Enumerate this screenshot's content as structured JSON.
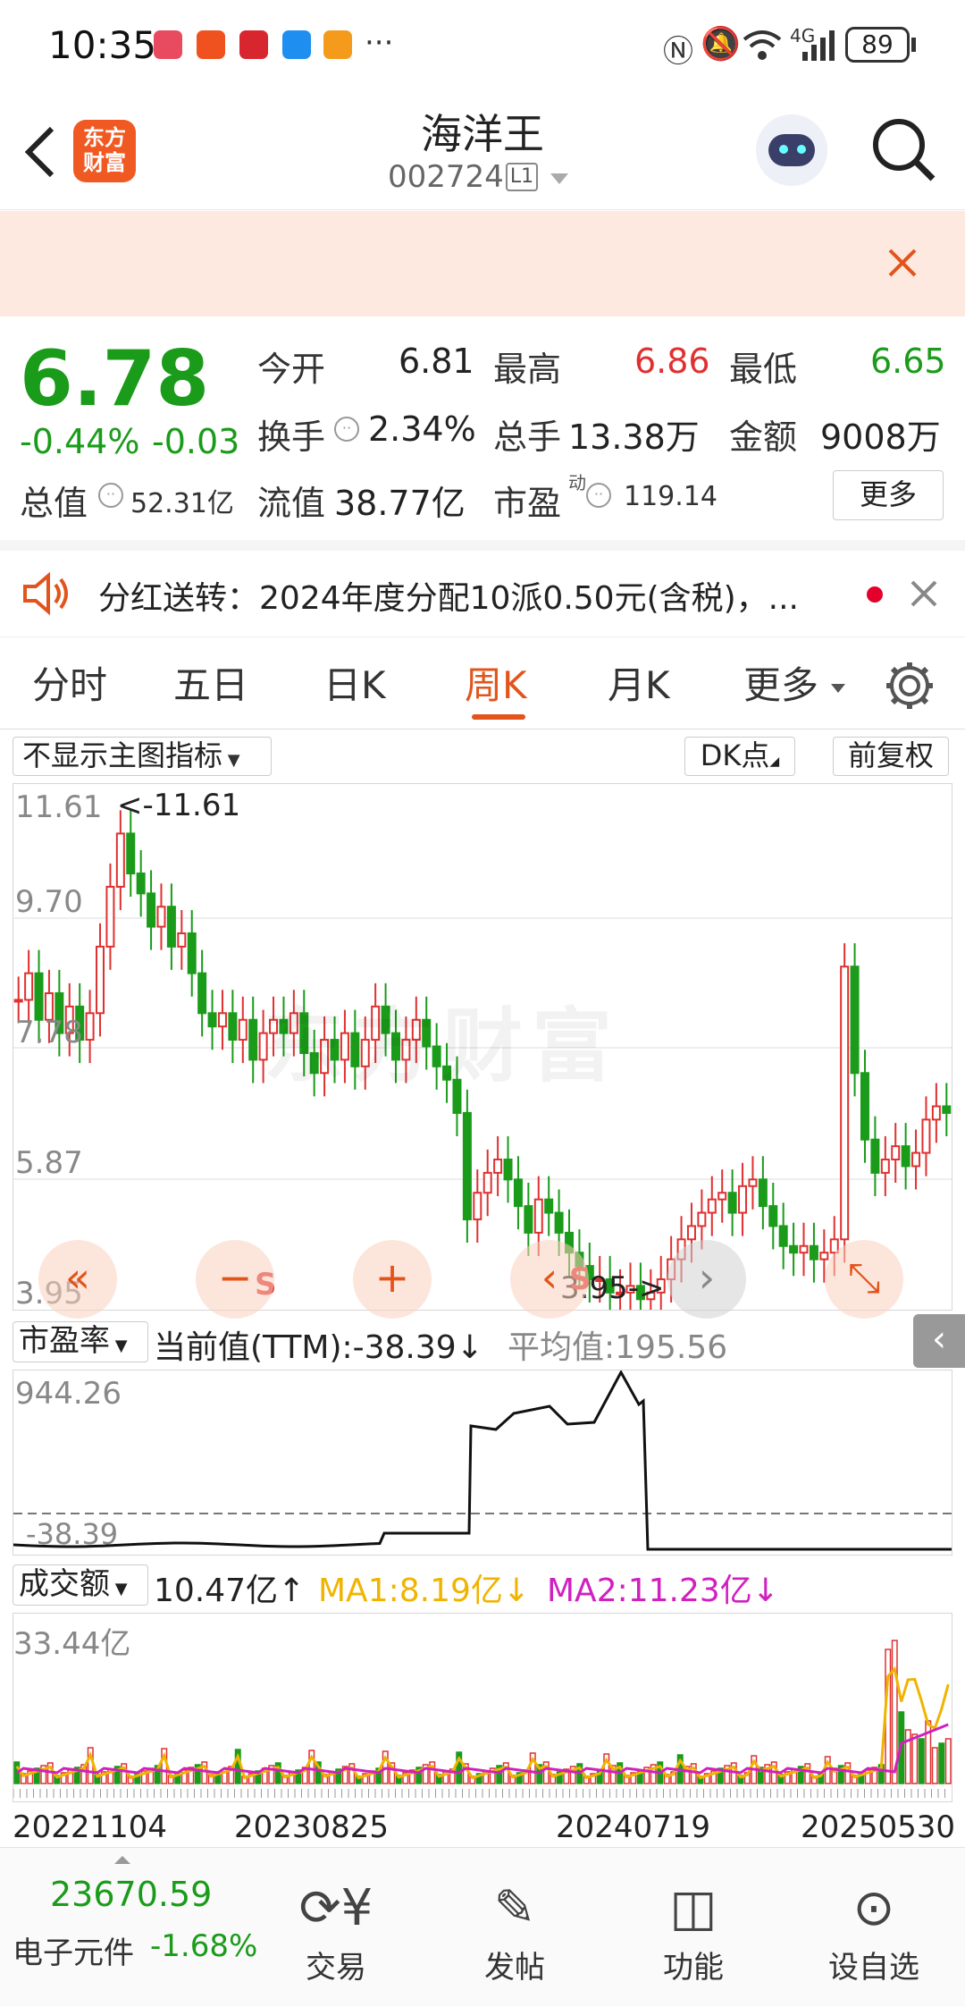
{
  "status": {
    "time": "10:35",
    "more": "···",
    "battery": "89",
    "signal": "4G"
  },
  "header": {
    "logo_line1": "东方",
    "logo_line2": "财富",
    "title": "海洋王",
    "code": "002724",
    "level": "L1"
  },
  "quote": {
    "price": "6.78",
    "change_pct": "-0.44%",
    "change": "-0.03",
    "open_label": "今开",
    "open": "6.81",
    "high_label": "最高",
    "high": "6.86",
    "low_label": "最低",
    "low": "6.65",
    "turnover_label": "换手",
    "turnover": "2.34%",
    "volume_label": "总手",
    "volume": "13.38万",
    "amount_label": "金额",
    "amount": "9008万",
    "mktcap_label": "总值",
    "mktcap": "52.31亿",
    "float_label": "流值",
    "float": "38.77亿",
    "pe_label": "市盈",
    "pe_sup": "动",
    "pe": "119.14",
    "more_button": "更多"
  },
  "news": {
    "text": "分红送转：2024年度分配10派0.50元(含税)，..."
  },
  "tabs": [
    "分时",
    "五日",
    "日K",
    "周K",
    "月K",
    "更多"
  ],
  "active_tab": "周K",
  "chart_controls": {
    "indicator_select": "不显示主图指标",
    "dk_button": "DK点",
    "adjust_button": "前复权"
  },
  "main_chart": {
    "y_labels": [
      "11.61",
      "9.70",
      "7.78",
      "5.87",
      "3.95"
    ],
    "max_label": "<-11.61",
    "min_label": "3.95->",
    "watermark": "东方财富",
    "s_marker_1": "S",
    "s_marker_2": "S"
  },
  "pe_panel": {
    "selector": "市盈率",
    "current": "当前值(TTM):-38.39",
    "current_arrow": "↓",
    "average": "平均值:195.56",
    "y_top": "944.26",
    "y_bottom": "-38.39"
  },
  "vol_panel": {
    "selector": "成交额",
    "value": "10.47亿",
    "value_arrow": "↑",
    "ma1": "MA1:8.19亿",
    "ma1_arrow": "↓",
    "ma2": "MA2:11.23亿",
    "ma2_arrow": "↓",
    "y_top": "33.44亿"
  },
  "x_labels": [
    "20221104",
    "20230825",
    "20240719",
    "20250530"
  ],
  "bottom_nav": {
    "index_value": "23670.59",
    "index_name": "电子元件",
    "index_change": "-1.68%",
    "trade": "交易",
    "post": "发帖",
    "function": "功能",
    "watch": "设自选"
  },
  "colors": {
    "accent": "#e2541c",
    "up": "#e03030",
    "down": "#1a9b1a",
    "ma1": "#f0b400",
    "ma2": "#d020c0"
  }
}
